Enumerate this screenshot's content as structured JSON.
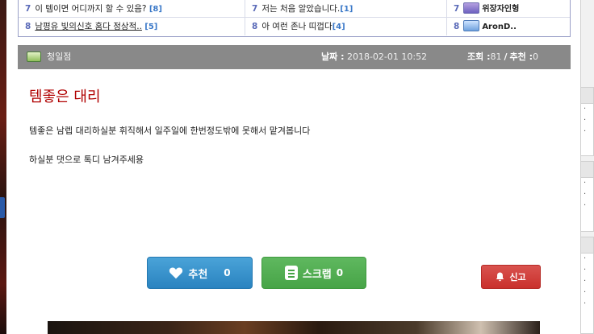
{
  "top_list": {
    "row1": [
      {
        "rank": "7",
        "title": "이 템이면 어디까지 할 수 있음?",
        "count": "[8]"
      },
      {
        "rank": "7",
        "title": "저는 처음 알았습니다.",
        "count": "[1]"
      },
      {
        "rank": "7",
        "title": "위장자인형"
      }
    ],
    "row2": [
      {
        "rank": "8",
        "title": "남평유 빛의신호 홈다 정상적..",
        "count": "[5]"
      },
      {
        "rank": "8",
        "title": "아 여런 존나 띠껍다",
        "count": "[4]"
      },
      {
        "rank": "8",
        "title": "AronD.."
      }
    ]
  },
  "post_info": {
    "author": "청일점",
    "date_label": "날짜 :",
    "date_value": "2018-02-01 10:52",
    "views_label": "조회 :",
    "views_value": "81",
    "separator": "/",
    "recommend_label": "추천 :",
    "recommend_value": "0"
  },
  "post": {
    "title": "템좋은 대리",
    "line1": "템좋은 남렙 대리하실분 휘직해서 일주일에 한번정도밖에 못해서 맡겨봅니다",
    "line2": "하실분 댓으로 톡디 남겨주세용"
  },
  "actions": {
    "recommend_label": "추천",
    "recommend_count": "0",
    "scrap_label": "스크랩",
    "scrap_count": "0",
    "report_label": "신고"
  },
  "colors": {
    "title": "#b00000",
    "info_bar": "#898989",
    "recommend_btn": "#2a83c0",
    "scrap_btn": "#47a447",
    "report_btn": "#c9302c"
  }
}
